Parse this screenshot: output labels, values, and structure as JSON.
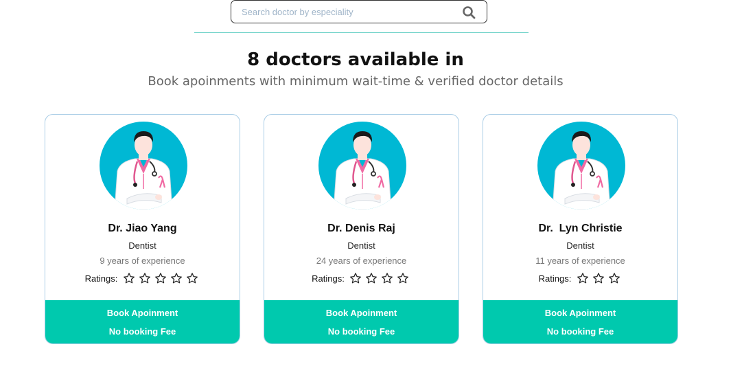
{
  "search": {
    "placeholder": "Search doctor by especiality",
    "icon": "search-icon"
  },
  "heading": "8 doctors available in",
  "subheading": "Book apoinments with minimum wait-time & verified doctor details",
  "colors": {
    "accent": "#00c9ae",
    "avatar_bg": "#00b8d4",
    "card_border": "#a9cde6",
    "divider": "#6fd3c9"
  },
  "doctors": [
    {
      "name": "Dr. Jiao Yang",
      "speciality": "Dentist",
      "experience": "9 years of experience",
      "ratings_label": "Ratings:",
      "stars": 5,
      "book_label": "Book Apoinment",
      "fee_label": "No booking Fee"
    },
    {
      "name": "Dr. Denis Raj",
      "speciality": "Dentist",
      "experience": "24 years of experience",
      "ratings_label": "Ratings:",
      "stars": 4,
      "book_label": "Book Apoinment",
      "fee_label": "No booking Fee"
    },
    {
      "name": "Dr.  Lyn Christie",
      "speciality": "Dentist",
      "experience": "11 years of experience",
      "ratings_label": "Ratings:",
      "stars": 3,
      "book_label": "Book Apoinment",
      "fee_label": "No booking Fee"
    }
  ]
}
